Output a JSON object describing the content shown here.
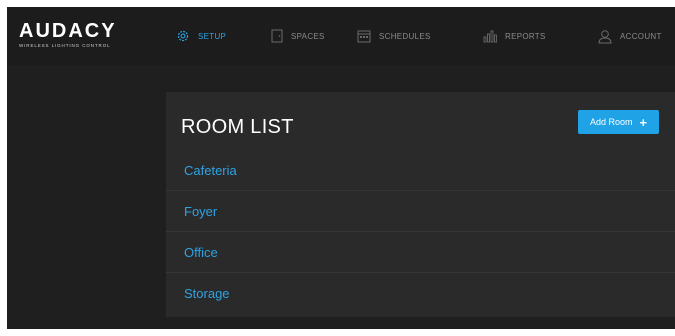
{
  "brand": {
    "name": "AUDACY",
    "tagline": "WIRELESS LIGHTING CONTROL"
  },
  "nav": [
    {
      "label": "SETUP",
      "icon": "gear-icon",
      "active": true
    },
    {
      "label": "SPACES",
      "icon": "door-icon",
      "active": false
    },
    {
      "label": "SCHEDULES",
      "icon": "calendar-icon",
      "active": false
    },
    {
      "label": "REPORTS",
      "icon": "bar-chart-icon",
      "active": false
    },
    {
      "label": "ACCOUNT",
      "icon": "user-icon",
      "active": false
    }
  ],
  "room_list": {
    "title": "ROOM LIST",
    "add_button_label": "Add Room",
    "add_button_icon": "plus-icon",
    "rooms": [
      "Cafeteria",
      "Foyer",
      "Office",
      "Storage"
    ]
  },
  "colors": {
    "accent": "#2ea3e3",
    "button": "#1fa3e6",
    "background": "#1f1f1f",
    "panel": "#2a2a2a"
  }
}
